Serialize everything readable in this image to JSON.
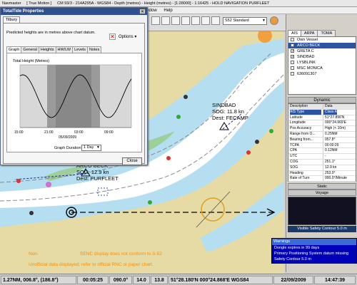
{
  "app": {
    "title_segments": [
      "Navmaster",
      "[ True Motion ]",
      "CM 93/3 - 214A295A - WGS84 - Depth (metres) - Height (metres) - [1:28000] - 1:16425 - HOLD NAVIGATION PURFLEET"
    ],
    "menu": [
      "indow",
      "Help"
    ]
  },
  "toolbar": {
    "standard_select": "S52 Standard"
  },
  "dialog": {
    "title": "TotalTide Properties",
    "location_tab": "Tilbury",
    "note": "Predicted heights are in metres above chart datum.",
    "options_label": "Options",
    "tabs": [
      "Graph",
      "General",
      "Heights",
      "HW/LW",
      "Levels",
      "Notes"
    ],
    "active_tab": "Graph",
    "graph": {
      "title": "Total Height (Metres)",
      "time_ticks": [
        "15:00",
        "21:00",
        "03:00",
        "09:00"
      ],
      "date": "05/09/2009"
    },
    "duration_label": "Graph Duration",
    "duration_value": "1 Day",
    "close_label": "Close"
  },
  "right_panel": {
    "tabs": [
      "AIS",
      "ARPA",
      "TOMA"
    ],
    "active_tab": "AIS",
    "vessels": [
      {
        "name": "Own Vessel",
        "checked": false,
        "selected": false
      },
      {
        "name": "ARCO BECK",
        "checked": true,
        "selected": true
      },
      {
        "name": "GRETA C",
        "checked": true,
        "selected": false
      },
      {
        "name": "SINDBAD",
        "checked": true,
        "selected": false
      },
      {
        "name": "LYSBLINK",
        "checked": false,
        "selected": false
      },
      {
        "name": "MSC MONICA",
        "checked": false,
        "selected": false
      },
      {
        "name": "636091307",
        "checked": false,
        "selected": false
      }
    ],
    "dynamic_header": "Dynamic",
    "dynamic_table": {
      "columns": [
        "Description",
        "Data"
      ],
      "rows": [
        {
          "k": "AIS Type",
          "v": "Class A",
          "selected": true
        },
        {
          "k": "Latitude",
          "v": "51°27.896'N",
          "selected": false
        },
        {
          "k": "Longitude",
          "v": "000°24.969'E",
          "selected": false
        },
        {
          "k": "Pos Accuracy",
          "v": "High (< 10m)",
          "selected": false
        },
        {
          "k": "Range from O...",
          "v": "0.25NM",
          "selected": false
        },
        {
          "k": "Bearing from...",
          "v": "057.8°",
          "selected": false
        },
        {
          "k": "TCPA",
          "v": "00:00:29",
          "selected": false
        },
        {
          "k": "CPA",
          "v": "0.12NM",
          "selected": false
        },
        {
          "k": "UTC",
          "v": "-",
          "selected": false
        },
        {
          "k": "COG",
          "v": "251.1°",
          "selected": false
        },
        {
          "k": "SOG",
          "v": "12.9 kn",
          "selected": false
        },
        {
          "k": "Heading",
          "v": "253.0°",
          "selected": false
        },
        {
          "k": "Rate of Turn",
          "v": "000.0°/Minute",
          "selected": false
        }
      ]
    },
    "static_label": "Static",
    "voyage_label": "Voyage",
    "safety_contour": "Visible Safety Contour 5.0 m"
  },
  "chart": {
    "labels": {
      "sindbad": [
        "SINDBAD",
        "SOG: 11.8 kn",
        "Dest: FECAMP"
      ],
      "arco": [
        "ARCO BECK",
        "SOG: 12.9 kn",
        "Dest: PURFLEET"
      ],
      "warning1": "SENC display does not conform to S-52",
      "warning1_prefix": "Non-",
      "warning2": "Unofficial data displayed; refer to official RNC or paper chart."
    }
  },
  "warnings": {
    "title": "Warnings",
    "lines": [
      "Dongle expires in 99 days",
      "Primary Positioning System datum missing",
      "Safety Contour 5.0 m"
    ]
  },
  "status": {
    "range": "1.27NM, 006.8°, (186.8°)",
    "timer": "00:05:25",
    "heading": "090.0°",
    "speed": "14.0",
    "depth": "13.8",
    "position": "51°28.180'N 000°24.868'E WGS84",
    "date": "22/09/2009",
    "time": "14:47:39"
  },
  "colors": {
    "deep_water": "#ffffff",
    "shallow": "#b5dff0",
    "intertidal": "#9ecf9a",
    "land": "#e6dba4",
    "dialog_title": "#2f4f8f",
    "warning_text": "#ff8c00"
  }
}
